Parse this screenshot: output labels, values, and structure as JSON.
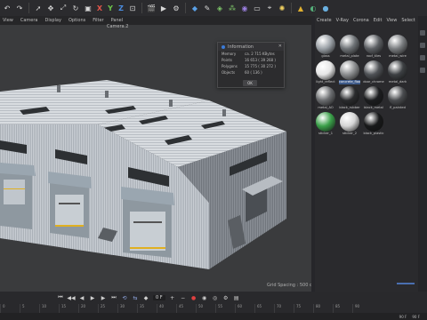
{
  "toolbar": {
    "axes": [
      "X",
      "Y",
      "Z"
    ],
    "icons": [
      "undo-icon",
      "redo-icon",
      "select-icon",
      "move-icon",
      "scale-icon",
      "rotate-icon",
      "object-icon",
      "render-view-icon",
      "render-icon",
      "render-settings-icon",
      "cube-icon",
      "pen-icon",
      "subdivide-icon",
      "cloner-icon",
      "deformer-icon",
      "floor-icon",
      "camera-icon",
      "light-icon",
      "tag-icon"
    ]
  },
  "viewport": {
    "menu": [
      "View",
      "Camera",
      "Display",
      "Options",
      "Filter",
      "Panel"
    ],
    "camera_label": "Camera.2",
    "grid_spacing": "Grid Spacing : 500 cm"
  },
  "info_dialog": {
    "title": "Information",
    "rows": [
      {
        "key": "Memory",
        "value": "ca. 2 715 KBytes"
      },
      {
        "key": "Points",
        "value": "16 653 ( 39 268 )"
      },
      {
        "key": "Polygons",
        "value": "15 775 ( 30 272 )"
      },
      {
        "key": "Objects",
        "value": "60 ( 136 )"
      }
    ],
    "ok_label": "OK"
  },
  "material_panel": {
    "menu": [
      "Create",
      "V-Ray",
      "Corona",
      "Edit",
      "View",
      "Select"
    ],
    "materials": [
      {
        "label": "glass",
        "color": "#9aa0a6"
      },
      {
        "label": "metal_plate",
        "color": "#6e7276"
      },
      {
        "label": "roof_tiles",
        "color": "#5c5f63"
      },
      {
        "label": "metal_wire",
        "color": "#7a7d80"
      },
      {
        "label": "light_reflect",
        "color": "#e6e6e6"
      },
      {
        "label": "concrete_floor",
        "color": "#8b8d8f"
      },
      {
        "label": "door_chrome",
        "color": "#4f5256"
      },
      {
        "label": "metal_dark",
        "color": "#3d4043"
      },
      {
        "label": "metal_AO",
        "color": "#6b6d70"
      },
      {
        "label": "black_rubber",
        "color": "#2a2b2d"
      },
      {
        "label": "black_metal",
        "color": "#1c1d1f"
      },
      {
        "label": "fl_painted",
        "color": "#4a4c4f"
      },
      {
        "label": "sticker_1",
        "color": "#3aa049"
      },
      {
        "label": "sticker_2",
        "color": "#d5d5d5"
      },
      {
        "label": "black_plastic",
        "color": "#18191a"
      }
    ],
    "selected_index": 5
  },
  "timeline": {
    "frame": "0 F",
    "ruler": [
      "0",
      "5",
      "10",
      "15",
      "20",
      "25",
      "30",
      "35",
      "40",
      "45",
      "50",
      "55",
      "60",
      "65",
      "70",
      "75",
      "80",
      "85",
      "90"
    ],
    "end_fields": [
      "90 F",
      "90 F"
    ]
  }
}
